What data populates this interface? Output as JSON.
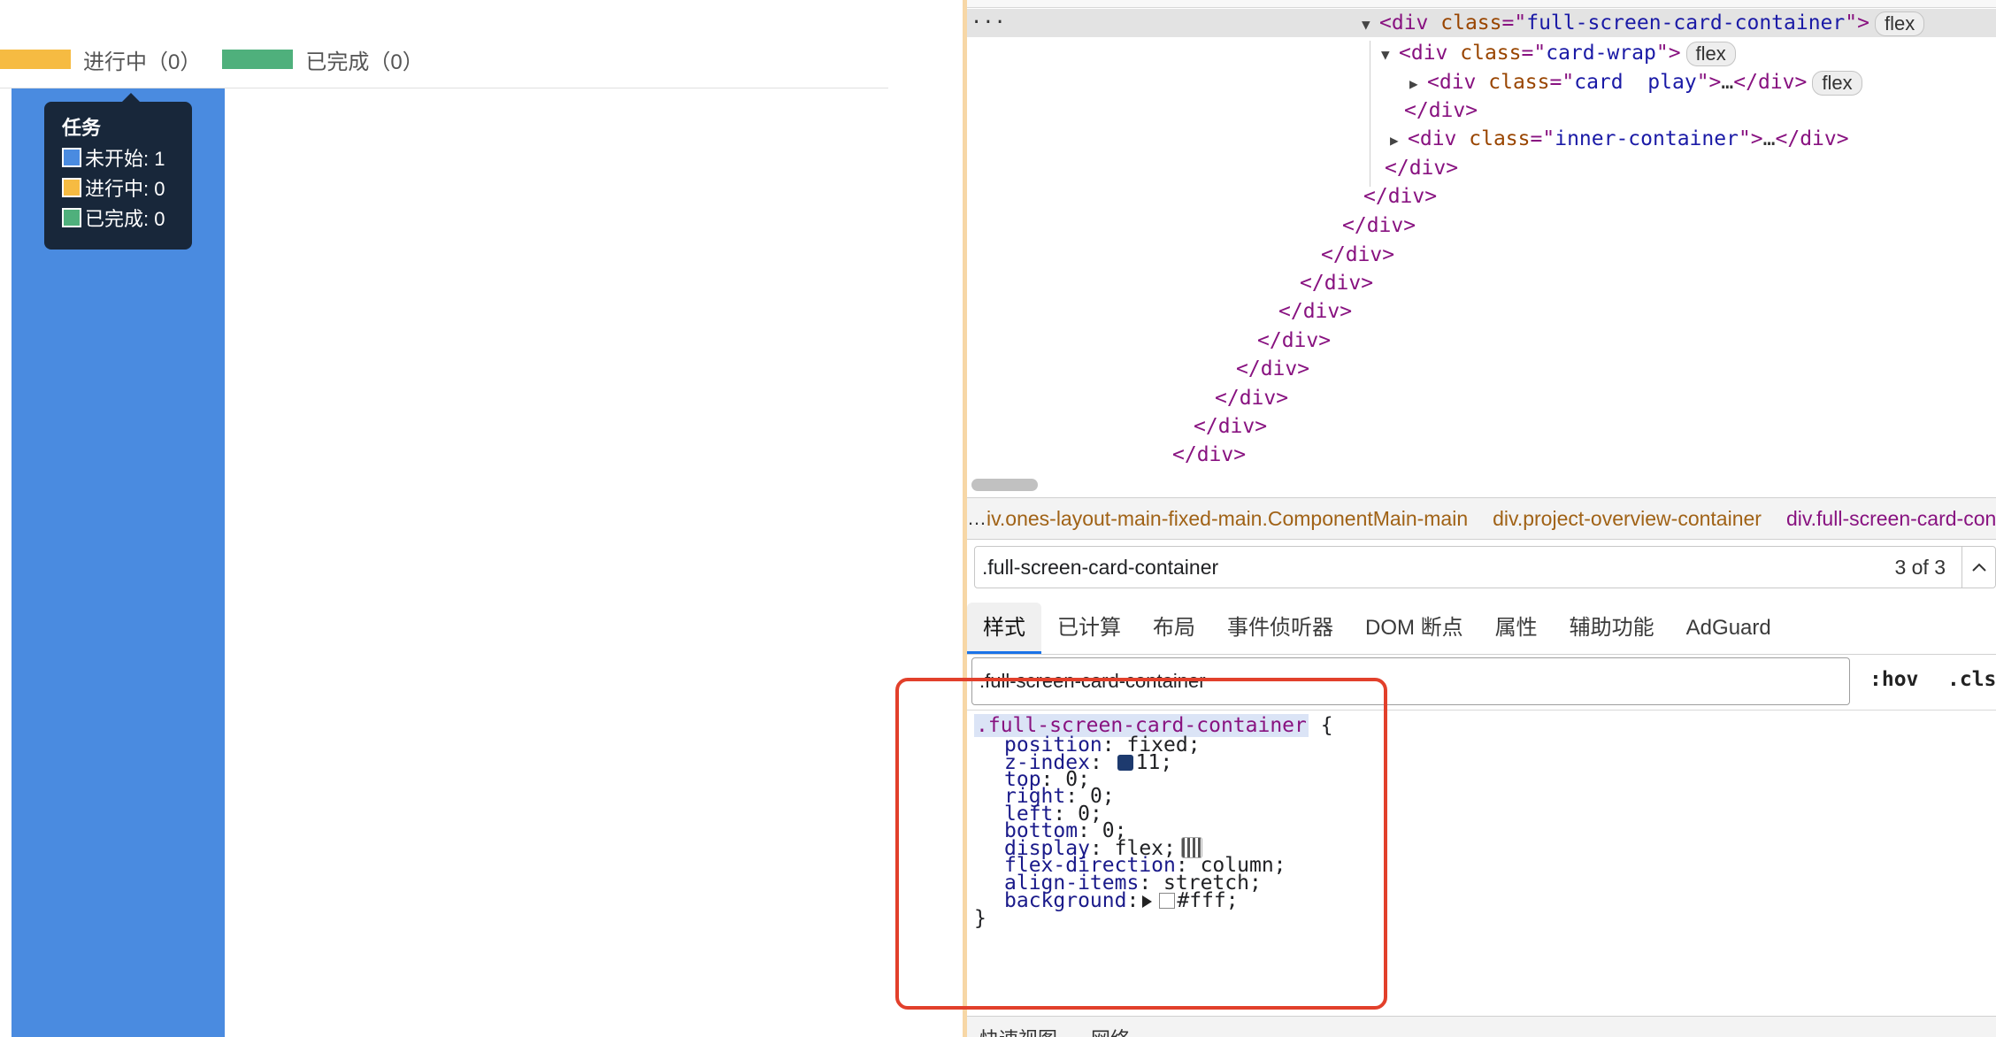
{
  "chart_data": {
    "type": "bar",
    "categories": [
      ""
    ],
    "series": [
      {
        "name": "未开始",
        "values": [
          1
        ],
        "color": "#4a8be0"
      },
      {
        "name": "进行中",
        "values": [
          0
        ],
        "color": "#f6bb42"
      },
      {
        "name": "已完成",
        "values": [
          0
        ],
        "color": "#4fb07c"
      }
    ],
    "legend": {
      "placement": "top-left",
      "items": [
        "进行中（0）",
        "已完成（0）"
      ]
    },
    "tooltip": {
      "title": "任务",
      "rows": [
        "未开始: 1",
        "进行中: 0",
        "已完成: 0"
      ]
    },
    "ylim": [
      0,
      1
    ]
  },
  "colors": {
    "not_started": "#4a8be0",
    "in_progress": "#f6bb42",
    "done": "#4fb07c"
  },
  "devtools": {
    "top_ellipsis": "···",
    "dom": {
      "line0": {
        "tag": "div",
        "attr": "class",
        "val": "full-screen-card-container",
        "badge": "flex"
      },
      "line1": {
        "tag": "div",
        "attr": "class",
        "val": "card-wrap",
        "badge": "flex"
      },
      "line2": {
        "tag": "div",
        "attr": "class",
        "val": "card  play",
        "ellipsis": "…",
        "badge": "flex"
      },
      "close": "</div>",
      "line4": {
        "tag": "div",
        "attr": "class",
        "val": "inner-container",
        "ellipsis": "…"
      }
    },
    "breadcrumb": {
      "more": "…",
      "items": [
        "iv.ones-layout-main-fixed-main.ComponentMain-main",
        "div.project-overview-container",
        "div.full-screen-card-container"
      ]
    },
    "search": {
      "value": ".full-screen-card-container",
      "count": "3 of 3",
      "up_icon": "chevron-up-icon"
    },
    "tabs": [
      "样式",
      "已计算",
      "布局",
      "事件侦听器",
      "DOM 断点",
      "属性",
      "辅助功能",
      "AdGuard"
    ],
    "filter": {
      "value": ".full-screen-card-container",
      "hov": ":hov",
      "cls": ".cls"
    },
    "rule": {
      "selector": ".full-screen-card-container",
      "open_brace": "{",
      "close_brace": "}",
      "props": [
        {
          "name": "position",
          "value": "fixed;"
        },
        {
          "name": "z-index",
          "value": "11;"
        },
        {
          "name": "top",
          "value": "0;"
        },
        {
          "name": "right",
          "value": "0;"
        },
        {
          "name": "left",
          "value": "0;"
        },
        {
          "name": "bottom",
          "value": "0;"
        },
        {
          "name": "display",
          "value": "flex;"
        },
        {
          "name": "flex-direction",
          "value": "column;"
        },
        {
          "name": "align-items",
          "value": "stretch;"
        },
        {
          "name": "background",
          "value": "#fff;"
        }
      ]
    },
    "bottom_tabs": [
      "快速视图",
      "网络"
    ]
  }
}
